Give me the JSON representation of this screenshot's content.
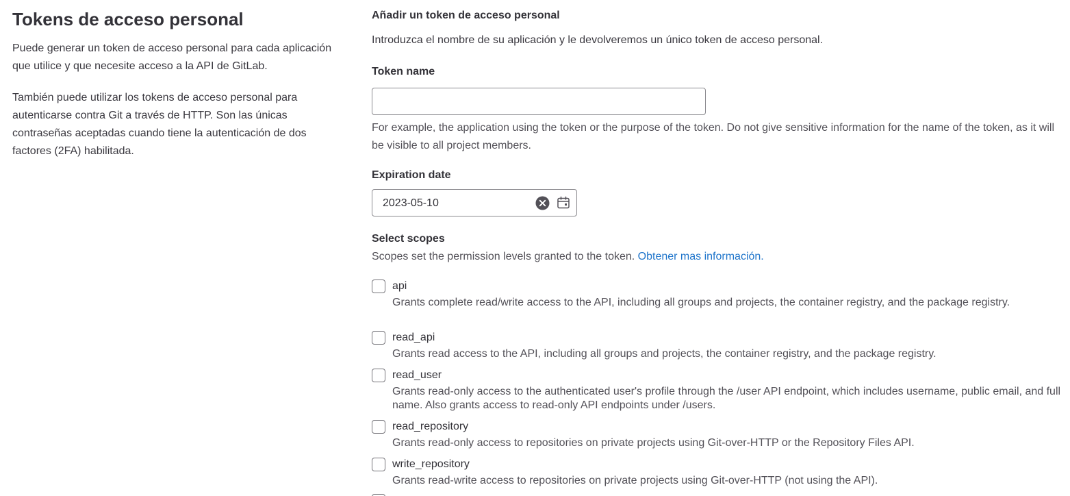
{
  "left": {
    "title": "Tokens de acceso personal",
    "paragraph1": "Puede generar un token de acceso personal para cada aplicación que utilice y que necesite acceso a la API de GitLab.",
    "paragraph2": "También puede utilizar los tokens de acceso personal para autenticarse contra Git a través de HTTP. Son las únicas contraseñas aceptadas cuando tiene la autenticación de dos factores (2FA) habilitada."
  },
  "form": {
    "section_title": "Añadir un token de acceso personal",
    "section_desc": "Introduzca el nombre de su aplicación y le devolveremos un único token de acceso personal.",
    "token_name_label": "Token name",
    "token_name_value": "",
    "token_name_help": "For example, the application using the token or the purpose of the token. Do not give sensitive information for the name of the token, as it will be visible to all project members.",
    "expiration_label": "Expiration date",
    "expiration_value": "2023-05-10",
    "scopes_label": "Select scopes",
    "scopes_desc": "Scopes set the permission levels granted to the token.",
    "scopes_link": "Obtener mas información.",
    "scopes": [
      {
        "name": "api",
        "checked": false,
        "desc": "Grants complete read/write access to the API, including all groups and projects, the container registry, and the package registry."
      },
      {
        "name": "read_api",
        "checked": false,
        "desc": "Grants read access to the API, including all groups and projects, the container registry, and the package registry."
      },
      {
        "name": "read_user",
        "checked": false,
        "desc": "Grants read-only access to the authenticated user's profile through the /user API endpoint, which includes username, public email, and full name. Also grants access to read-only API endpoints under /users."
      },
      {
        "name": "read_repository",
        "checked": false,
        "desc": "Grants read-only access to repositories on private projects using Git-over-HTTP or the Repository Files API."
      },
      {
        "name": "write_repository",
        "checked": false,
        "desc": "Grants read-write access to repositories on private projects using Git-over-HTTP (not using the API)."
      }
    ]
  },
  "colors": {
    "link": "#1f75cb",
    "text": "#333238",
    "muted": "#535158",
    "border": "#89888d"
  }
}
